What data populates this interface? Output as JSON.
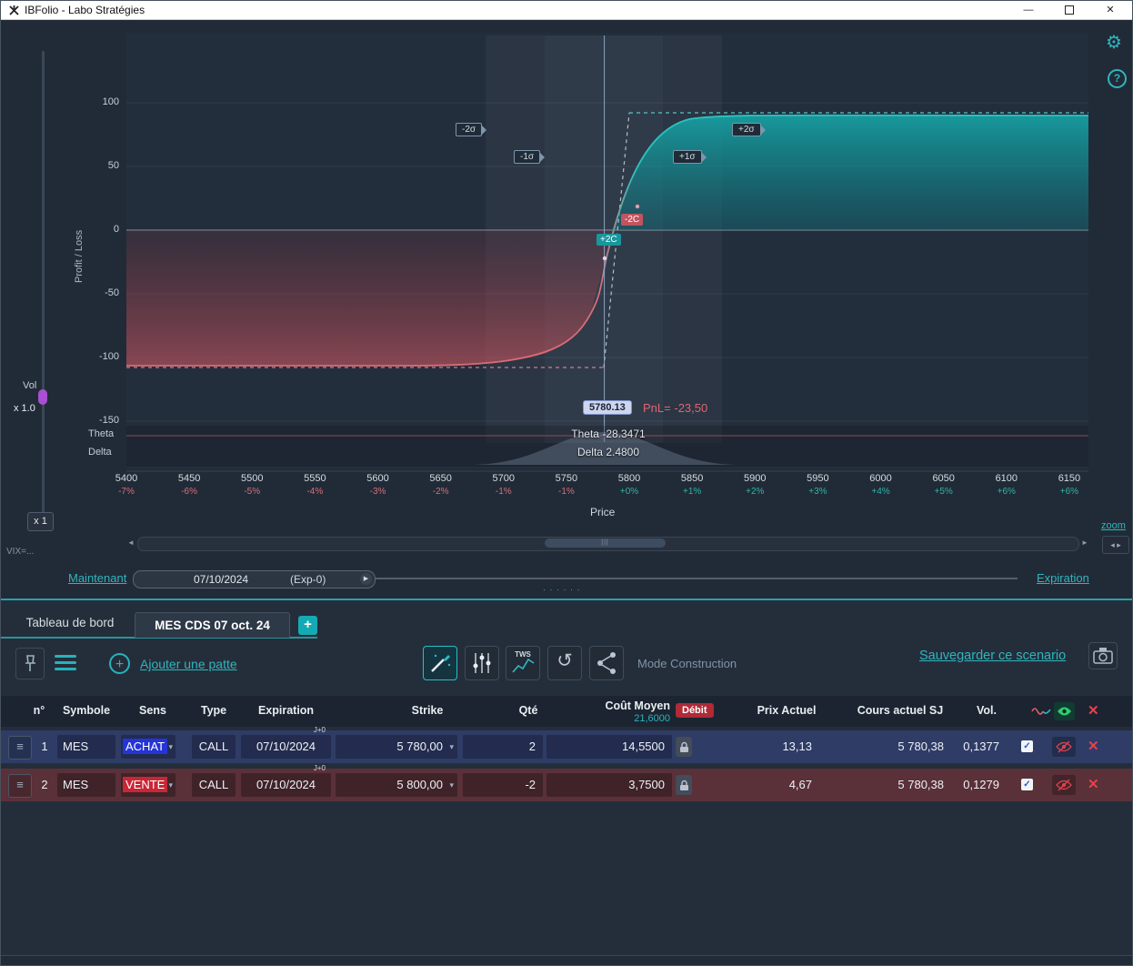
{
  "window": {
    "title": "IBFolio - Labo Stratégies"
  },
  "chart": {
    "ylabel": "Profit / Loss",
    "xlabel": "Price",
    "y_ticks": [
      "100",
      "50",
      "0",
      "-50",
      "-100",
      "-150"
    ],
    "x_ticks": [
      {
        "price": "5400",
        "pct": "-7%"
      },
      {
        "price": "5450",
        "pct": "-6%"
      },
      {
        "price": "5500",
        "pct": "-5%"
      },
      {
        "price": "5550",
        "pct": "-4%"
      },
      {
        "price": "5600",
        "pct": "-3%"
      },
      {
        "price": "5650",
        "pct": "-2%"
      },
      {
        "price": "5700",
        "pct": "-1%"
      },
      {
        "price": "5750",
        "pct": "-1%"
      },
      {
        "price": "5800",
        "pct": "+0%"
      },
      {
        "price": "5850",
        "pct": "+1%"
      },
      {
        "price": "5900",
        "pct": "+2%"
      },
      {
        "price": "5950",
        "pct": "+3%"
      },
      {
        "price": "6000",
        "pct": "+4%"
      },
      {
        "price": "6050",
        "pct": "+5%"
      },
      {
        "price": "6100",
        "pct": "+6%"
      },
      {
        "price": "6150",
        "pct": "+6%"
      }
    ],
    "sigma": [
      "-2σ",
      "-1σ",
      "+1σ",
      "+2σ"
    ],
    "spot_label": "5780.13",
    "pnl_prefix": "PnL=",
    "pnl_value": "-23,50",
    "theta_name": "Theta",
    "delta_name": "Delta",
    "theta_text": "Theta -28.3471",
    "delta_text": "Delta 2.4800",
    "marker_plus": "+2C",
    "marker_minus": "-2C",
    "vol_label": "Vol",
    "vol_value": "x 1.0",
    "mult_label": "x 1",
    "vix_label": "VIX=...",
    "zoom_label": "zoom"
  },
  "timeline": {
    "now_label": "Maintenant",
    "date": "07/10/2024",
    "exp_label": "(Exp-0)",
    "expiration_label": "Expiration"
  },
  "tabs": {
    "dashboard": "Tableau de bord",
    "strategy": "MES CDS 07 oct. 24",
    "add": "+"
  },
  "toolbar": {
    "add_leg_label": "Ajouter une patte",
    "tws_label": "TWS",
    "mode_label": "Mode Construction",
    "save_label": "Sauvegarder ce scenario"
  },
  "table": {
    "headers": {
      "num": "n°",
      "symbol": "Symbole",
      "side": "Sens",
      "type": "Type",
      "expiration": "Expiration",
      "strike": "Strike",
      "qty": "Qté",
      "avg_cost": "Coût Moyen",
      "price": "Prix Actuel",
      "underlying": "Cours actuel SJ",
      "vol": "Vol."
    },
    "avg_cost_total": "21,6000",
    "debit_label": "Débit",
    "rows": [
      {
        "num": "1",
        "symbol": "MES",
        "side": "ACHAT",
        "type": "CALL",
        "expiration": "07/10/2024",
        "dte": "J+0",
        "strike": "5 780,00",
        "qty": "2",
        "avg_cost": "14,5500",
        "price": "13,13",
        "underlying": "5 780,38",
        "vol": "0,1377"
      },
      {
        "num": "2",
        "symbol": "MES",
        "side": "VENTE",
        "type": "CALL",
        "expiration": "07/10/2024",
        "dte": "J+0",
        "strike": "5 800,00",
        "qty": "-2",
        "avg_cost": "3,7500",
        "price": "4,67",
        "underlying": "5 780,38",
        "vol": "0,1279"
      }
    ]
  },
  "icons": {
    "minimize": "—",
    "close": "✕",
    "caret_down": "▾",
    "play": "▶",
    "scroll_left": "◄",
    "scroll_right": "►",
    "zoom_left": "◂",
    "zoom_right": "▸",
    "grip": "|||",
    "check": "✓",
    "row_close": "✕",
    "handle": "≡",
    "history": "↺",
    "help": "?",
    "gear": "⚙",
    "dots": "· · · · · ·",
    "plus": "+"
  }
}
